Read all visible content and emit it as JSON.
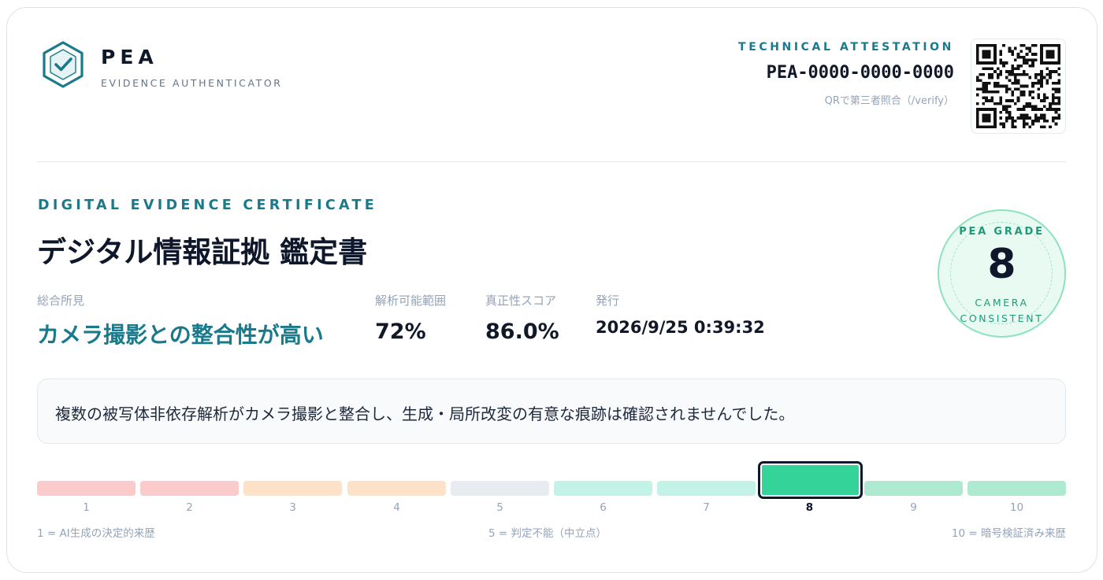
{
  "brand": {
    "name": "PEA",
    "subtitle": "EVIDENCE AUTHENTICATOR"
  },
  "attestation": {
    "label": "TECHNICAL ATTESTATION",
    "id": "PEA-0000-0000-0000",
    "note": "QRで第三者照合（/verify）"
  },
  "certificate": {
    "eyebrow": "DIGITAL EVIDENCE CERTIFICATE",
    "title": "デジタル情報証拠 鑑定書"
  },
  "meta": {
    "finding_label": "総合所見",
    "finding_value": "カメラ撮影との整合性が高い",
    "coverage_label": "解析可能範囲",
    "coverage_value": "72%",
    "authenticity_label": "真正性スコア",
    "authenticity_value": "86.0%",
    "issued_label": "発行",
    "issued_value": "2026/9/25 0:39:32"
  },
  "grade": {
    "label": "PEA GRADE",
    "value": "8",
    "caption_line1": "CAMERA",
    "caption_line2": "CONSISTENT"
  },
  "summary": {
    "text": "複数の被写体非依存解析がカメラ撮影と整合し、生成・局所改変の有意な痕跡は確認されませんでした。"
  },
  "scale": {
    "selected": 8,
    "segments": [
      {
        "label": "1",
        "color": "#fbcaca"
      },
      {
        "label": "2",
        "color": "#fbcaca"
      },
      {
        "label": "3",
        "color": "#fde2c8"
      },
      {
        "label": "4",
        "color": "#fde2c8"
      },
      {
        "label": "5",
        "color": "#e8ecf1"
      },
      {
        "label": "6",
        "color": "#c2f3e6"
      },
      {
        "label": "7",
        "color": "#c2f3e6"
      },
      {
        "label": "8",
        "color": "#34d399"
      },
      {
        "label": "9",
        "color": "#aeead2"
      },
      {
        "label": "10",
        "color": "#aeead2"
      }
    ],
    "legend_left": "1 = AI生成の決定的来歴",
    "legend_center": "5 = 判定不能（中立点）",
    "legend_right": "10 = 暗号検証済み来歴"
  },
  "colors": {
    "accent": "#1a7a8c",
    "grade_green": "#34d399"
  },
  "icons": {
    "logo": "shield-check-hexagon-icon",
    "qr": "qr-code"
  }
}
